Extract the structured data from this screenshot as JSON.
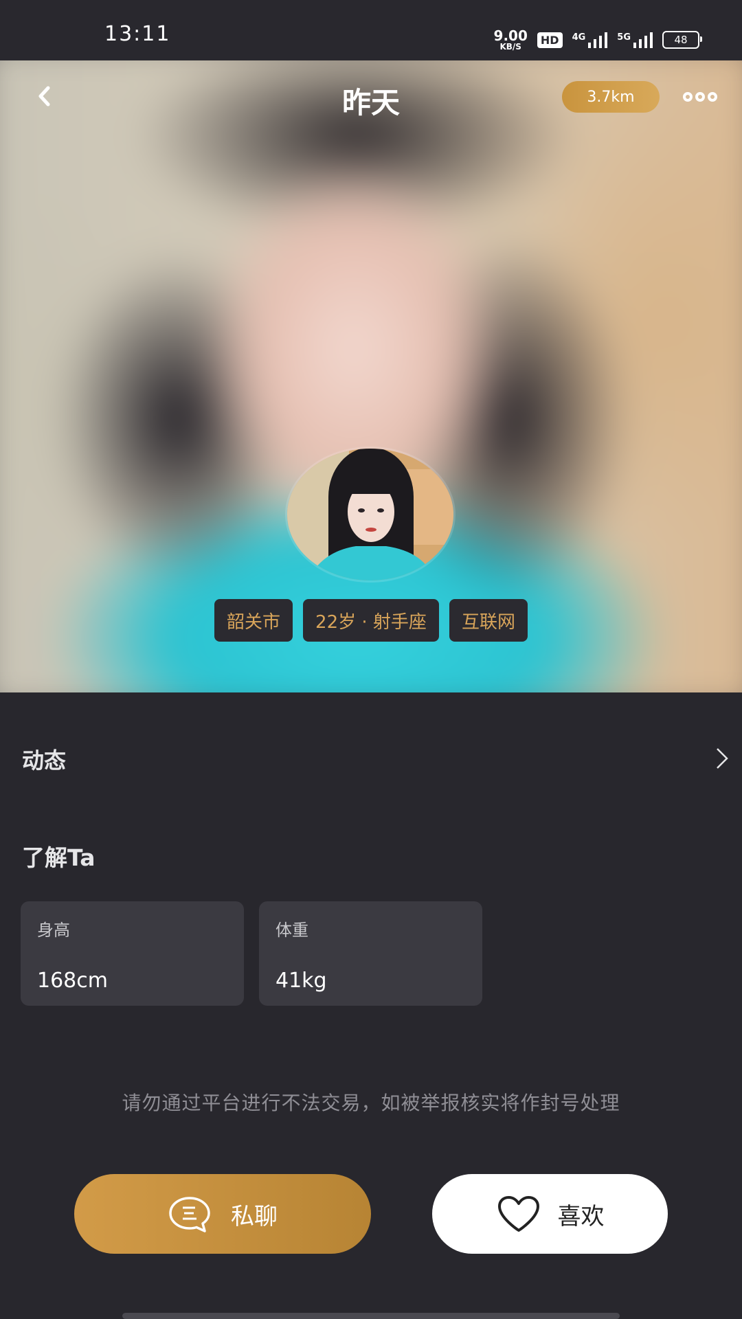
{
  "status_bar": {
    "time": "13:11",
    "net_speed": "9.00",
    "net_speed_unit": "KB/S",
    "hd": "HD",
    "net1": "4G",
    "net2": "5G",
    "battery": "48"
  },
  "header": {
    "title": "昨天",
    "distance": "3.7km"
  },
  "tags": [
    "韶关市",
    "22岁 · 射手座",
    "互联网"
  ],
  "moments": {
    "label": "动态"
  },
  "about": {
    "title": "了解Ta",
    "cards": [
      {
        "key": "身高",
        "value": "168cm"
      },
      {
        "key": "体重",
        "value": "41kg"
      }
    ]
  },
  "notice": "请勿通过平台进行不法交易，如被举报核实将作封号处理",
  "actions": {
    "chat_label": "私聊",
    "like_label": "喜欢"
  },
  "colors": {
    "accent": "#c9943e",
    "tag_text": "#d9a55a",
    "background": "#28272d",
    "card": "#3b3a41"
  }
}
